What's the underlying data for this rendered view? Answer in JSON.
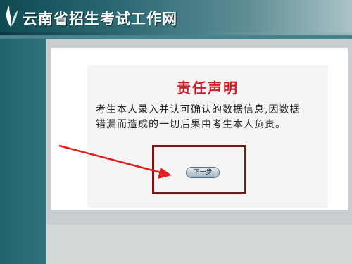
{
  "header": {
    "site_title": "云南省招生考试工作网"
  },
  "notice": {
    "title": "责任声明",
    "line1": "考生本人录入并认可确认的数据信息,因数据",
    "line2": "错漏而造成的一切后果由考生本人负责。"
  },
  "actions": {
    "next_label": "下一步"
  },
  "colors": {
    "header_dark": "#0f4a53",
    "title_red": "#c8202a",
    "annotation_red": "#e02020",
    "box_border": "#7a1616"
  },
  "icons": {
    "logo": "leaf-logo-icon"
  }
}
